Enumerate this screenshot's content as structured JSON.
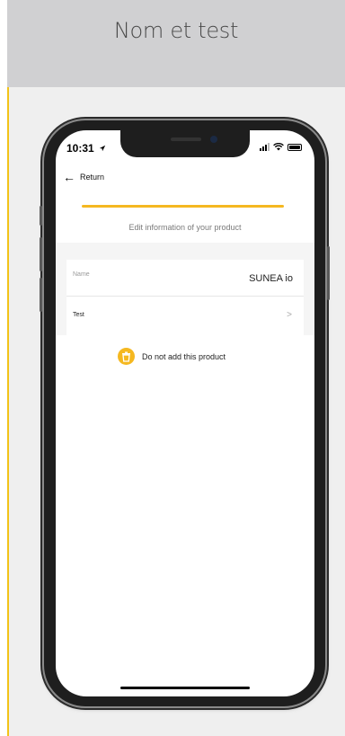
{
  "header": {
    "title": "Nom et test"
  },
  "colors": {
    "accent": "#f5b820",
    "header_bg": "#d0d0d2",
    "stage_bg": "#efefef"
  },
  "status_bar": {
    "time": "10:31",
    "icons": [
      "location-arrow-icon",
      "signal-icon",
      "wifi-icon",
      "battery-icon"
    ]
  },
  "nav": {
    "back_icon": "arrow-left-icon",
    "back_label": "Return"
  },
  "progress": {
    "value": 1.0
  },
  "page": {
    "subtitle": "Edit information of your product"
  },
  "form": {
    "name_label": "Name",
    "name_value": "SUNEA io",
    "test_label": "Test",
    "test_icon": "chevron-right-icon"
  },
  "actions": {
    "skip_icon": "trash-icon",
    "skip_label": "Do not add this product"
  }
}
